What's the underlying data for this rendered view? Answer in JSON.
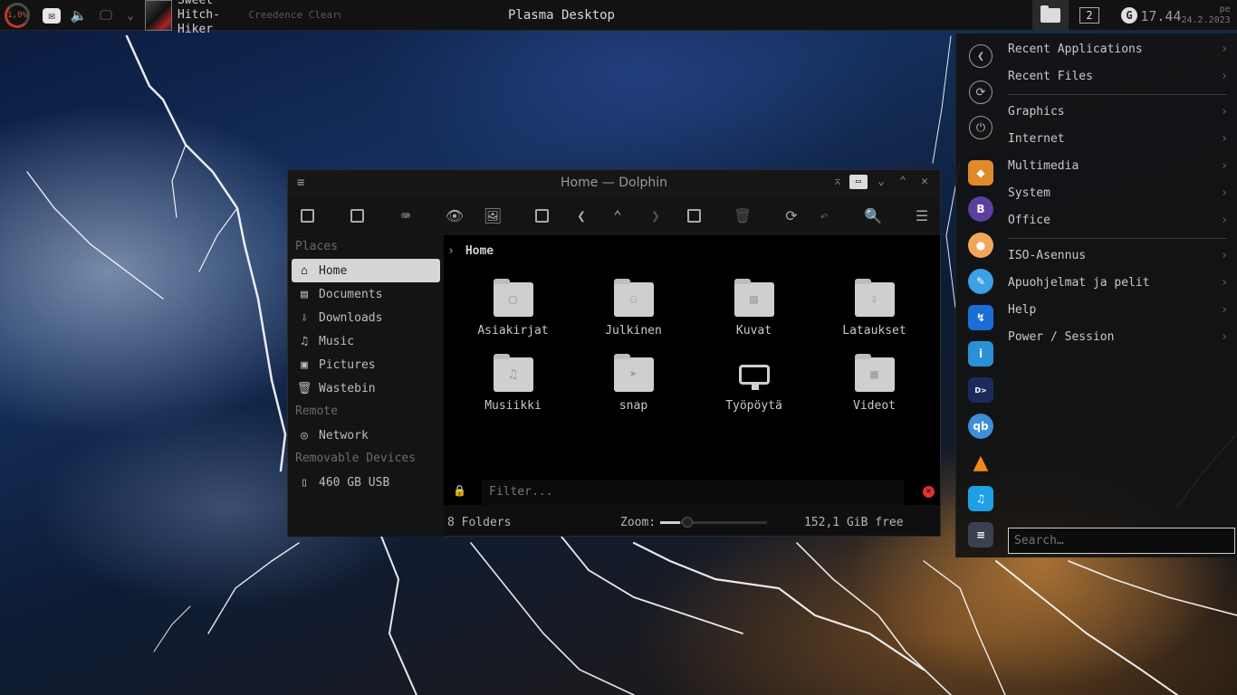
{
  "panel": {
    "song_title": "Sweet Hitch-Hiker",
    "song_artist": "Creedence Clearwater Revi…",
    "window_title": "Plasma Desktop",
    "vdesk_number": "2",
    "clock_time": "17.44",
    "clock_date": "pe 24.2.2023",
    "cpu_label": "1,0%"
  },
  "window": {
    "title": "Home — Dolphin",
    "breadcrumb": "Home",
    "places": {
      "header_places": "Places",
      "header_remote": "Remote",
      "header_removable": "Removable Devices",
      "items": [
        {
          "label": "Home",
          "icon": "home-icon"
        },
        {
          "label": "Documents",
          "icon": "document-icon"
        },
        {
          "label": "Downloads",
          "icon": "download-icon"
        },
        {
          "label": "Music",
          "icon": "music-icon"
        },
        {
          "label": "Pictures",
          "icon": "image-icon"
        },
        {
          "label": "Wastebin",
          "icon": "trash-icon"
        }
      ],
      "network": "Network",
      "usb": "460 GB USB"
    },
    "folders": [
      "Asiakirjat",
      "Julkinen",
      "Kuvat",
      "Lataukset",
      "Musiikki",
      "snap",
      "Työpöytä",
      "Videot"
    ],
    "filter_placeholder": "Filter...",
    "status": {
      "count": "8 Folders",
      "zoom_label": "Zoom:",
      "zoom_level": 0.25,
      "free": "152,1 GiB free"
    }
  },
  "launcher": {
    "categories": [
      "Recent Applications",
      "Recent Files",
      "Graphics",
      "Internet",
      "Multimedia",
      "System",
      "Office",
      "ISO-Asennus",
      "Apuohjelmat ja pelit",
      "Help",
      "Power / Session"
    ],
    "search_placeholder": "Search…"
  },
  "colors": {
    "accent_active": "#d6d6d6",
    "panel_bg": "#121212",
    "close_red": "#dd3333"
  }
}
